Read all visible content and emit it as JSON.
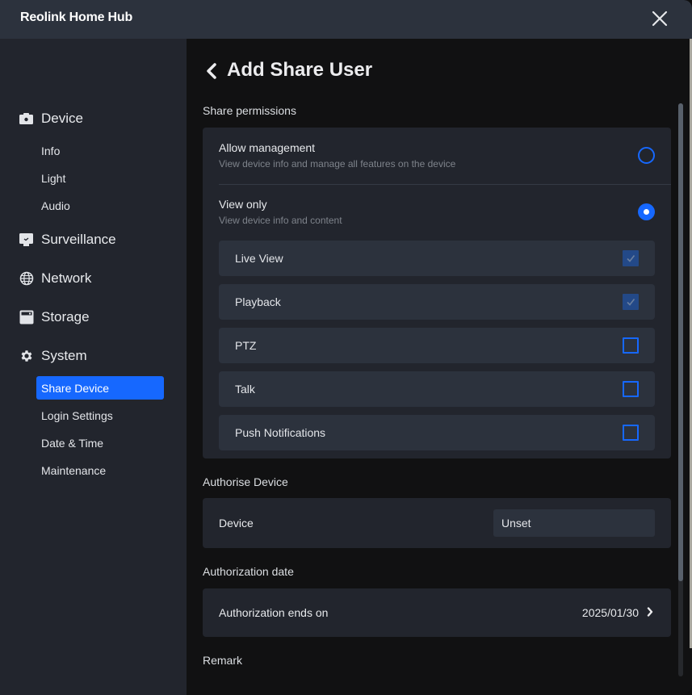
{
  "window": {
    "title": "Reolink Home Hub",
    "close_icon": "close-icon"
  },
  "sidebar": {
    "groups": [
      {
        "label": "Device",
        "icon": "camera-icon",
        "items": [
          {
            "label": "Info"
          },
          {
            "label": "Light"
          },
          {
            "label": "Audio"
          }
        ]
      },
      {
        "label": "Surveillance",
        "icon": "monitor-icon",
        "items": []
      },
      {
        "label": "Network",
        "icon": "globe-icon",
        "items": []
      },
      {
        "label": "Storage",
        "icon": "storage-icon",
        "items": []
      },
      {
        "label": "System",
        "icon": "gear-icon",
        "items": [
          {
            "label": "Share Device",
            "active": true
          },
          {
            "label": "Login Settings"
          },
          {
            "label": "Date & Time"
          },
          {
            "label": "Maintenance"
          }
        ]
      }
    ]
  },
  "main": {
    "title": "Add Share User",
    "back_icon": "chevron-left-icon",
    "share_permissions": {
      "label": "Share permissions",
      "options": [
        {
          "title": "Allow management",
          "description": "View device info and manage all features on the device",
          "selected": false
        },
        {
          "title": "View only",
          "description": "View device info and content",
          "selected": true
        }
      ],
      "permissions": [
        {
          "label": "Live View",
          "checked": true,
          "disabled": true
        },
        {
          "label": "Playback",
          "checked": true,
          "disabled": true
        },
        {
          "label": "PTZ",
          "checked": false
        },
        {
          "label": "Talk",
          "checked": false
        },
        {
          "label": "Push Notifications",
          "checked": false
        }
      ]
    },
    "authorise_device": {
      "label": "Authorise Device",
      "row_label": "Device",
      "value": "Unset"
    },
    "authorization_date": {
      "label": "Authorization date",
      "row_label": "Authorization ends on",
      "value": "2025/01/30"
    },
    "remark": {
      "label": "Remark"
    }
  },
  "colors": {
    "accent": "#1668ff",
    "titlebar": "#2c323d",
    "sidebar": "#22252d",
    "main_bg": "#111112",
    "card": "#22252d",
    "row": "#2c323d",
    "checked_disabled": "#234988"
  }
}
